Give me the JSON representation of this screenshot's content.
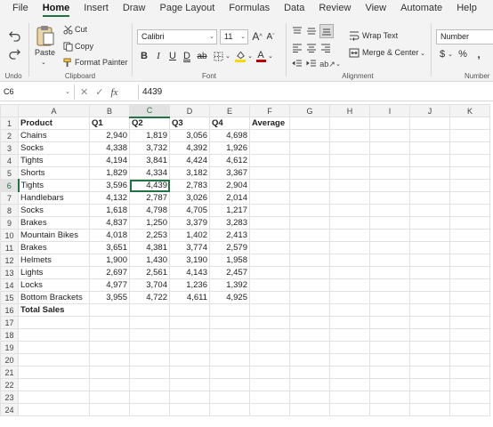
{
  "menu": {
    "tabs": [
      "File",
      "Home",
      "Insert",
      "Draw",
      "Page Layout",
      "Formulas",
      "Data",
      "Review",
      "View",
      "Automate",
      "Help"
    ],
    "active": "Home"
  },
  "ribbon": {
    "undo_group": "Undo",
    "clipboard": {
      "paste": "Paste",
      "cut": "Cut",
      "copy": "Copy",
      "format_painter": "Format Painter",
      "label": "Clipboard"
    },
    "font": {
      "name": "Calibri",
      "size": "11",
      "label": "Font"
    },
    "alignment": {
      "wrap_text": "Wrap Text",
      "merge_center": "Merge & Center",
      "label": "Alignment"
    },
    "number": {
      "format": "Number",
      "label": "Number"
    }
  },
  "formula_bar": {
    "name_box": "C6",
    "value": "4439"
  },
  "sheet": {
    "columns": [
      "A",
      "B",
      "C",
      "D",
      "E",
      "F",
      "G",
      "H",
      "I",
      "J",
      "K"
    ],
    "selected_column": "C",
    "selected_row": 6,
    "rows": [
      [
        "Product",
        "Q1",
        "Q2",
        "Q3",
        "Q4",
        "Average",
        "",
        "",
        "",
        "",
        ""
      ],
      [
        "Chains",
        "2,940",
        "1,819",
        "3,056",
        "4,698",
        "",
        "",
        "",
        "",
        "",
        ""
      ],
      [
        "Socks",
        "4,338",
        "3,732",
        "4,392",
        "1,926",
        "",
        "",
        "",
        "",
        "",
        ""
      ],
      [
        "Tights",
        "4,194",
        "3,841",
        "4,424",
        "4,612",
        "",
        "",
        "",
        "",
        "",
        ""
      ],
      [
        "Shorts",
        "1,829",
        "4,334",
        "3,182",
        "3,367",
        "",
        "",
        "",
        "",
        "",
        ""
      ],
      [
        "Tights",
        "3,596",
        "4,439",
        "2,783",
        "2,904",
        "",
        "",
        "",
        "",
        "",
        ""
      ],
      [
        "Handlebars",
        "4,132",
        "2,787",
        "3,026",
        "2,014",
        "",
        "",
        "",
        "",
        "",
        ""
      ],
      [
        "Socks",
        "1,618",
        "4,798",
        "4,705",
        "1,217",
        "",
        "",
        "",
        "",
        "",
        ""
      ],
      [
        "Brakes",
        "4,837",
        "1,250",
        "3,379",
        "3,283",
        "",
        "",
        "",
        "",
        "",
        ""
      ],
      [
        "Mountain Bikes",
        "4,018",
        "2,253",
        "1,402",
        "2,413",
        "",
        "",
        "",
        "",
        "",
        ""
      ],
      [
        "Brakes",
        "3,651",
        "4,381",
        "3,774",
        "2,579",
        "",
        "",
        "",
        "",
        "",
        ""
      ],
      [
        "Helmets",
        "1,900",
        "1,430",
        "3,190",
        "1,958",
        "",
        "",
        "",
        "",
        "",
        ""
      ],
      [
        "Lights",
        "2,697",
        "2,561",
        "4,143",
        "2,457",
        "",
        "",
        "",
        "",
        "",
        ""
      ],
      [
        "Locks",
        "4,977",
        "3,704",
        "1,236",
        "1,392",
        "",
        "",
        "",
        "",
        "",
        ""
      ],
      [
        "Bottom Brackets",
        "3,955",
        "4,722",
        "4,611",
        "4,925",
        "",
        "",
        "",
        "",
        "",
        ""
      ],
      [
        "Total Sales",
        "",
        "",
        "",
        "",
        "",
        "",
        "",
        "",
        "",
        ""
      ],
      [
        "",
        "",
        "",
        "",
        "",
        "",
        "",
        "",
        "",
        "",
        ""
      ],
      [
        "",
        "",
        "",
        "",
        "",
        "",
        "",
        "",
        "",
        "",
        ""
      ],
      [
        "",
        "",
        "",
        "",
        "",
        "",
        "",
        "",
        "",
        "",
        ""
      ],
      [
        "",
        "",
        "",
        "",
        "",
        "",
        "",
        "",
        "",
        "",
        ""
      ],
      [
        "",
        "",
        "",
        "",
        "",
        "",
        "",
        "",
        "",
        "",
        ""
      ],
      [
        "",
        "",
        "",
        "",
        "",
        "",
        "",
        "",
        "",
        "",
        ""
      ],
      [
        "",
        "",
        "",
        "",
        "",
        "",
        "",
        "",
        "",
        "",
        ""
      ],
      [
        "",
        "",
        "",
        "",
        "",
        "",
        "",
        "",
        "",
        "",
        ""
      ]
    ]
  },
  "colors": {
    "accent": "#217346",
    "font_color": "#c00000",
    "highlight": "#ffd700"
  }
}
